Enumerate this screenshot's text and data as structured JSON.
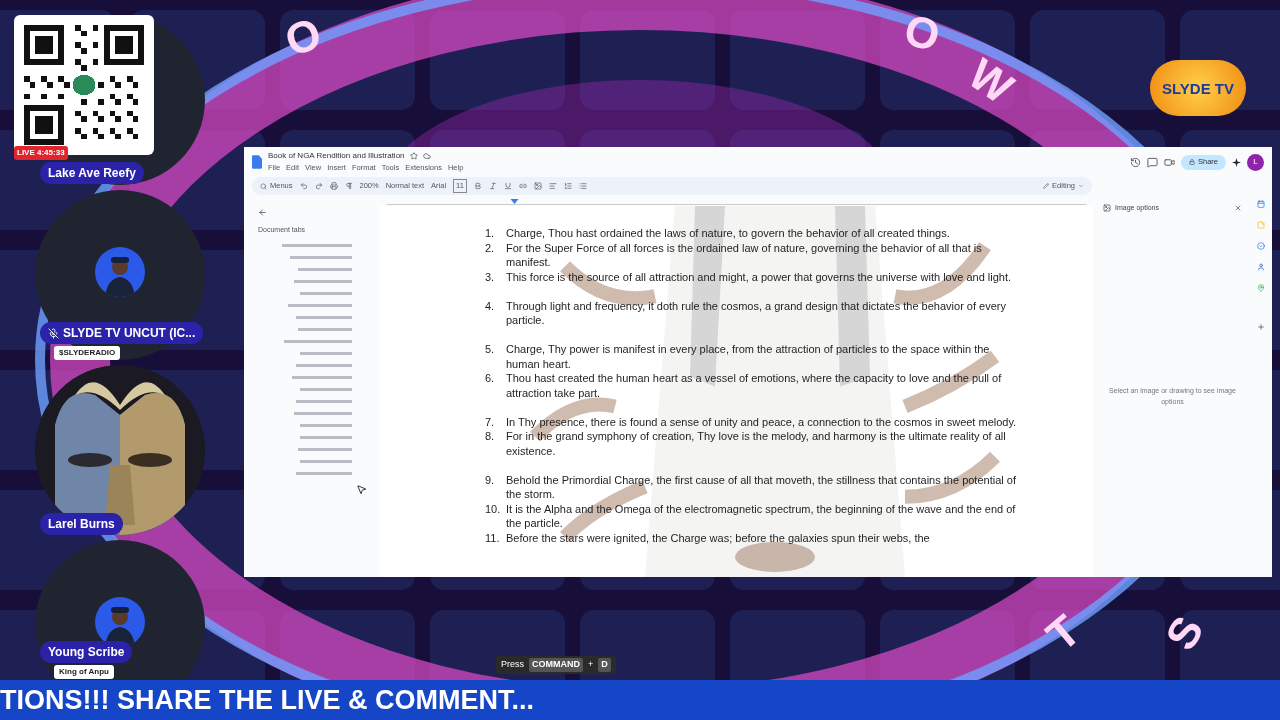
{
  "stream": {
    "ring_letters": [
      "O",
      "O",
      "W",
      "T",
      "S"
    ],
    "logo": "SLYDE TV",
    "live_badge": "LIVE 4:45:33",
    "participants": [
      {
        "name": "Lake Ave Reefy",
        "kind": "qr",
        "muted": false
      },
      {
        "name": "SLYDE TV UNCUT (IC...",
        "kind": "avatar",
        "muted": true,
        "subtitle": "$SLYDERADIO"
      },
      {
        "name": "Larel Burns",
        "muted": false
      },
      {
        "name": "Young Scribe",
        "kind": "avatar",
        "muted": false,
        "subtitle": "King of Anpu"
      }
    ],
    "shortcut_hint": {
      "prefix": "Press",
      "keys": [
        "COMMAND",
        "D"
      ],
      "joiner": "+"
    },
    "ticker": "TIONS!!! SHARE THE LIVE & COMMENT..."
  },
  "document": {
    "title": "Book of NGA Rendition and Illustration",
    "menu": [
      "File",
      "Edit",
      "View",
      "Insert",
      "Format",
      "Tools",
      "Extensions",
      "Help"
    ],
    "toolbar": {
      "search": "Menus",
      "zoom": "200%",
      "style": "Normal text",
      "font": "Arial",
      "font_size": "11",
      "mode": "Editing"
    },
    "share": "Share",
    "account_initial": "L",
    "outline_title": "Document tabs",
    "items": [
      {
        "number": "1.",
        "text": "Charge, Thou hast ordained the laws of nature, to govern the behavior of all created things.",
        "space_before": false
      },
      {
        "number": "2.",
        "text": "For the Super Force of all forces is the ordained law of nature, governing the behavior of all that is manifest.",
        "space_before": false
      },
      {
        "number": "3.",
        "text": "This force is the source of all attraction and might, a power that governs the universe with love and light.",
        "space_before": false
      },
      {
        "number": "4.",
        "text": "Through light and frequency, it doth rule the cosmos, a grand design that dictates the behavior of every particle.",
        "space_before": true
      },
      {
        "number": "5.",
        "text": "Charge, Thy power is manifest in every place, from the attraction of particles to the space within the human heart.",
        "space_before": true
      },
      {
        "number": "6.",
        "text": "Thou hast created the human heart as a vessel of emotions, where the capacity to love and the pull of attraction take part.",
        "space_before": false
      },
      {
        "number": "7.",
        "text": "In Thy presence, there is found a sense of unity and peace, a connection to the cosmos in sweet melody.",
        "space_before": true
      },
      {
        "number": "8.",
        "text": "For in the grand symphony of creation, Thy love is the melody, and harmony is the ultimate reality of all existence.",
        "space_before": false
      },
      {
        "number": "9.",
        "text": "Behold the Primordial Charge, the first cause of all that moveth, the stillness that contains the potential of the storm.",
        "space_before": true
      },
      {
        "number": "10.",
        "text": "It is the Alpha and the Omega of the electromagnetic spectrum, the beginning of the wave and the end of the particle.",
        "space_before": false
      },
      {
        "number": "11.",
        "text": "Before the stars were ignited, the Charge was; before the galaxies spun their webs, the",
        "space_before": false
      }
    ],
    "image_panel": {
      "title": "Image options",
      "hint": "Select an image or drawing to see image options"
    }
  }
}
